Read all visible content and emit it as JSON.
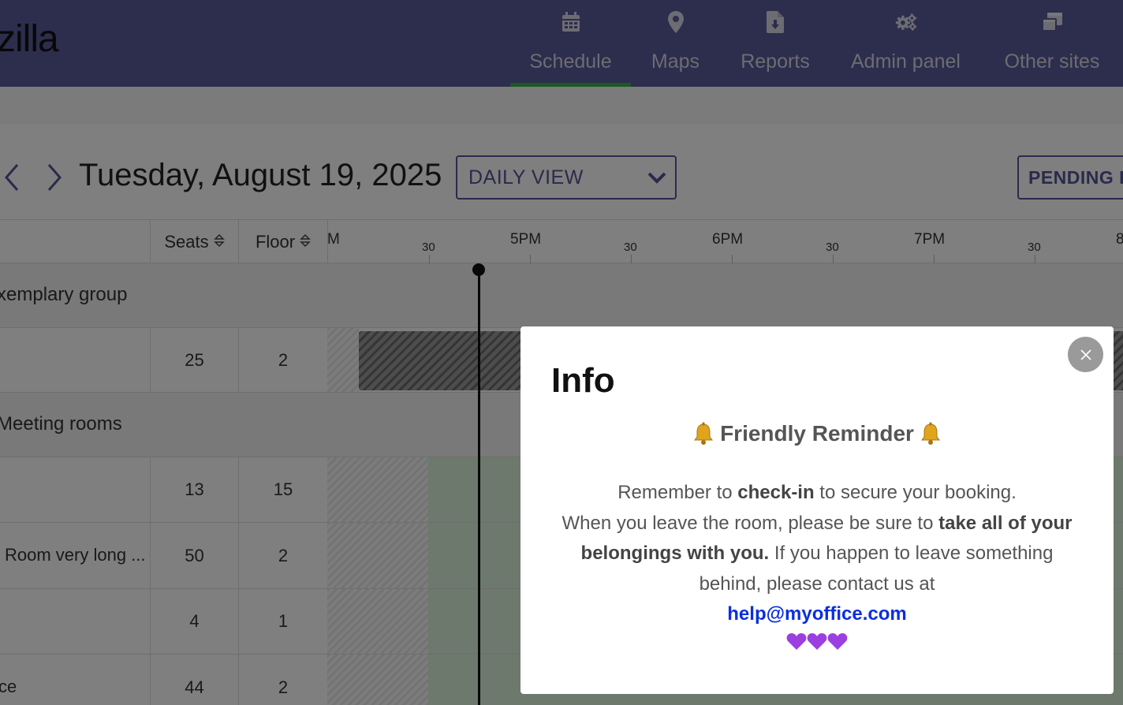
{
  "app": {
    "logo_text": "zilla"
  },
  "nav": {
    "items": [
      {
        "label": "Schedule",
        "icon": "calendar-icon",
        "active": true
      },
      {
        "label": "Maps",
        "icon": "map-pin-icon",
        "active": false
      },
      {
        "label": "Reports",
        "icon": "report-download-icon",
        "active": false
      },
      {
        "label": "Admin panel",
        "icon": "gears-icon",
        "active": false
      },
      {
        "label": "Other sites",
        "icon": "windows-icon",
        "active": false
      }
    ]
  },
  "toolbar": {
    "date": "Tuesday, August 19, 2025",
    "view_select": "DAILY VIEW",
    "pending_button": "PENDING F"
  },
  "grid": {
    "columns": {
      "seats": "Seats",
      "floor": "Floor"
    },
    "time_labels": [
      "M",
      "5PM",
      "6PM",
      "7PM",
      "8"
    ],
    "half_labels": [
      "30",
      "30",
      "30",
      "30"
    ],
    "groups": [
      {
        "name": "xemplary group",
        "rows": [
          {
            "name": "",
            "seats": "25",
            "floor": "2"
          }
        ]
      },
      {
        "name": "Meeting rooms",
        "rows": [
          {
            "name": "",
            "seats": "13",
            "floor": "15"
          },
          {
            "name": "Room very long ...",
            "seats": "50",
            "floor": "2"
          },
          {
            "name": "",
            "seats": "4",
            "floor": "1"
          },
          {
            "name": "ce",
            "seats": "44",
            "floor": "2"
          }
        ]
      }
    ]
  },
  "modal": {
    "title": "Info",
    "reminder_title": "Friendly Reminder",
    "line1_pre": "Remember to ",
    "line1_bold": "check-in",
    "line1_post": " to secure your booking.",
    "line2_pre": "When you leave the room, please be sure to ",
    "line2_bold": "take all of your belongings with you.",
    "line2_post": " If you happen to leave something behind, please contact us at",
    "email": "help@myoffice.com",
    "colors": {
      "heart": "#9b3fe0",
      "bell": "#e0a51c",
      "link": "#0b2ee0"
    }
  },
  "colors": {
    "header_bg": "#5a5a9a",
    "active_tab": "#35b24a",
    "accent": "#555598"
  }
}
